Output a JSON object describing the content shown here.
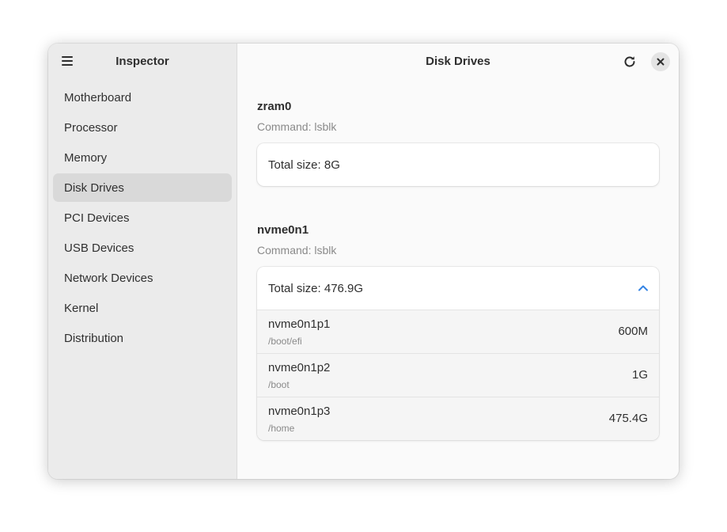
{
  "sidebar": {
    "title": "Inspector",
    "menu_icon": "hamburger-menu-icon",
    "items": [
      {
        "label": "Motherboard"
      },
      {
        "label": "Processor"
      },
      {
        "label": "Memory"
      },
      {
        "label": "Disk Drives",
        "selected": true
      },
      {
        "label": "PCI Devices"
      },
      {
        "label": "USB Devices"
      },
      {
        "label": "Network Devices"
      },
      {
        "label": "Kernel"
      },
      {
        "label": "Distribution"
      }
    ]
  },
  "header": {
    "title": "Disk Drives",
    "refresh_icon": "refresh-icon",
    "close_icon": "close-icon"
  },
  "drives": [
    {
      "name": "zram0",
      "command": "Command: lsblk",
      "total": "Total size: 8G",
      "expanded": false,
      "partitions": []
    },
    {
      "name": "nvme0n1",
      "command": "Command: lsblk",
      "total": "Total size: 476.9G",
      "expanded": true,
      "expander_icon": "chevron-up-icon",
      "partitions": [
        {
          "name": "nvme0n1p1",
          "mount": "/boot/efi",
          "size": "600M"
        },
        {
          "name": "nvme0n1p2",
          "mount": "/boot",
          "size": "1G"
        },
        {
          "name": "nvme0n1p3",
          "mount": "/home",
          "size": "475.4G"
        }
      ]
    }
  ],
  "colors": {
    "sidebar_bg": "#ebebeb",
    "selected_bg": "#d9d9d9",
    "accent": "#3584e4",
    "card_bg": "#ffffff"
  }
}
